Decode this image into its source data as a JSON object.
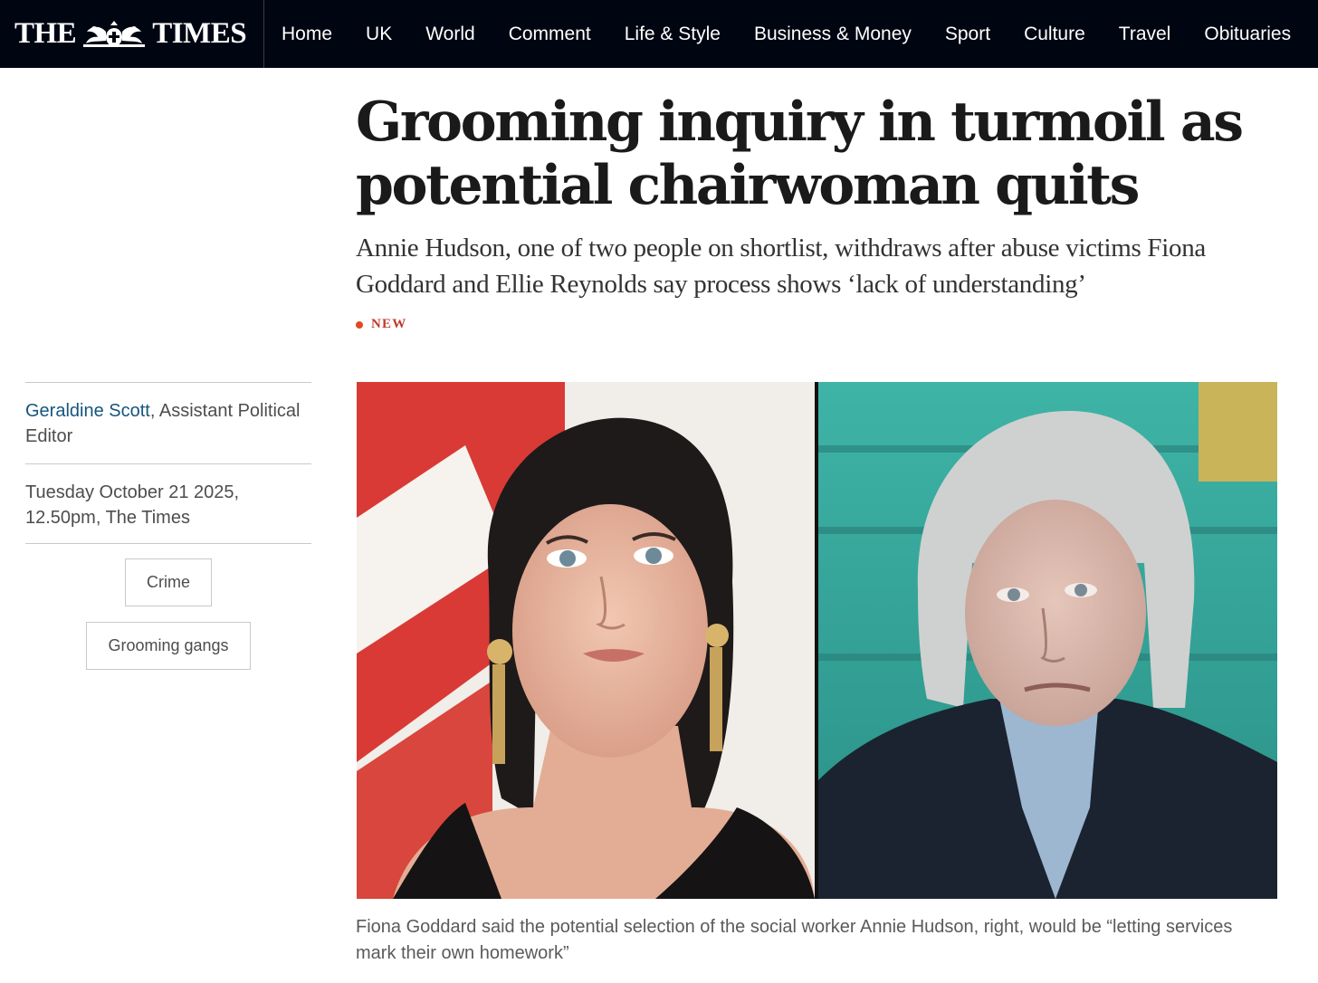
{
  "header": {
    "logo_left": "THE",
    "logo_right": "TIMES",
    "nav": [
      {
        "label": "Home"
      },
      {
        "label": "UK"
      },
      {
        "label": "World"
      },
      {
        "label": "Comment"
      },
      {
        "label": "Life & Style"
      },
      {
        "label": "Business & Money"
      },
      {
        "label": "Sport"
      },
      {
        "label": "Culture"
      },
      {
        "label": "Travel"
      },
      {
        "label": "Obituaries"
      }
    ]
  },
  "article": {
    "headline": "Grooming inquiry in turmoil as potential chairwoman quits",
    "standfirst": "Annie Hudson, one of two people on shortlist, withdraws after abuse victims Fiona Goddard and Ellie Reynolds say process shows ‘lack of understanding’",
    "badge": "NEW",
    "author": "Geraldine Scott",
    "author_role": ", Assistant Political Editor",
    "dateline": "Tuesday October 21 2025, 12.50pm, The Times",
    "tags": [
      "Crime",
      "Grooming gangs"
    ],
    "caption": "Fiona Goddard said the potential selection of the social worker Annie Hudson, right, would be “letting services mark their own homework”"
  },
  "colors": {
    "nav_background": "#000512",
    "byline_link": "#15557e",
    "new_badge": "#e04a1f"
  },
  "icons": [
    "crest-logo-icon",
    "new-dot-icon"
  ]
}
